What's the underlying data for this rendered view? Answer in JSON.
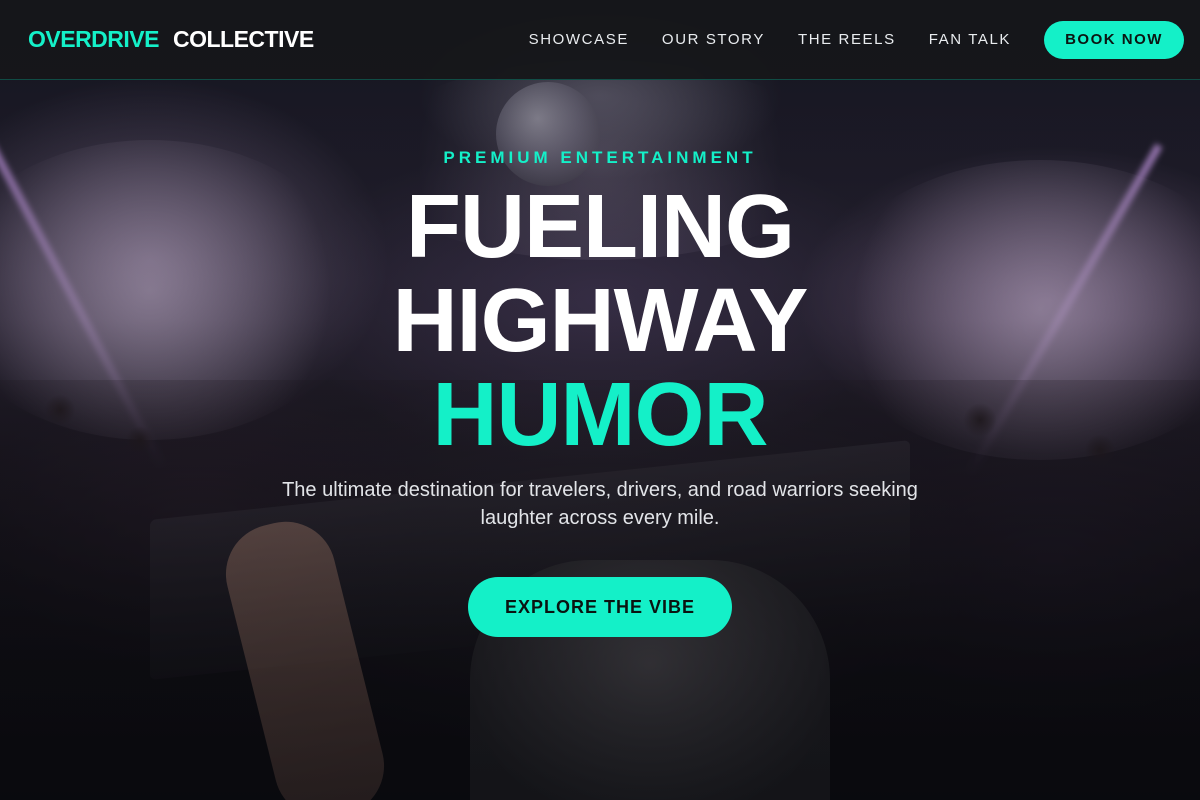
{
  "brand": {
    "accent": "OVERDRIVE",
    "main": "COLLECTIVE"
  },
  "nav": {
    "links": [
      "SHOWCASE",
      "OUR STORY",
      "THE REELS",
      "FAN TALK"
    ],
    "cta_label": "BOOK NOW"
  },
  "hero": {
    "eyebrow": "PREMIUM ENTERTAINMENT",
    "headline": [
      "FUELING",
      "HIGHWAY",
      "HUMOR"
    ],
    "subtitle": "The ultimate destination for travelers, drivers, and road warriors seeking laughter across every mile.",
    "cta_label": "EXPLORE THE VIBE"
  },
  "colors": {
    "accent": "#14f0c8",
    "nav_background": "#16171a",
    "text": "#ffffff"
  }
}
